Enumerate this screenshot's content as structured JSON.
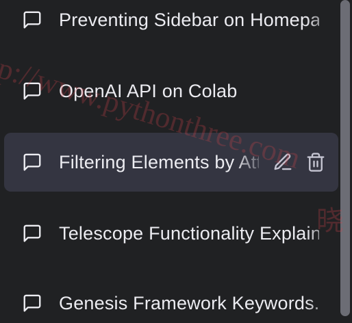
{
  "conversations": [
    {
      "label": "Preventing Sidebar on Homepage",
      "selected": false
    },
    {
      "label": "OpenAI API on Colab",
      "selected": false
    },
    {
      "label": "Filtering Elements by Attribute",
      "selected": true
    },
    {
      "label": "Telescope Functionality Explained",
      "selected": false
    },
    {
      "label": "Genesis Framework Keywords.",
      "selected": false
    }
  ],
  "icons": {
    "conversation": "chat-bubble-icon",
    "edit": "pencil-icon",
    "delete": "trash-icon"
  },
  "watermark": {
    "text": "p://www.pythonthree.com",
    "cjk_text": "晓"
  },
  "colors": {
    "background": "#202123",
    "selected_background": "#343541",
    "text": "#ececf1",
    "scrollbar_thumb": "#6c6d75",
    "watermark": "#d0464b"
  }
}
